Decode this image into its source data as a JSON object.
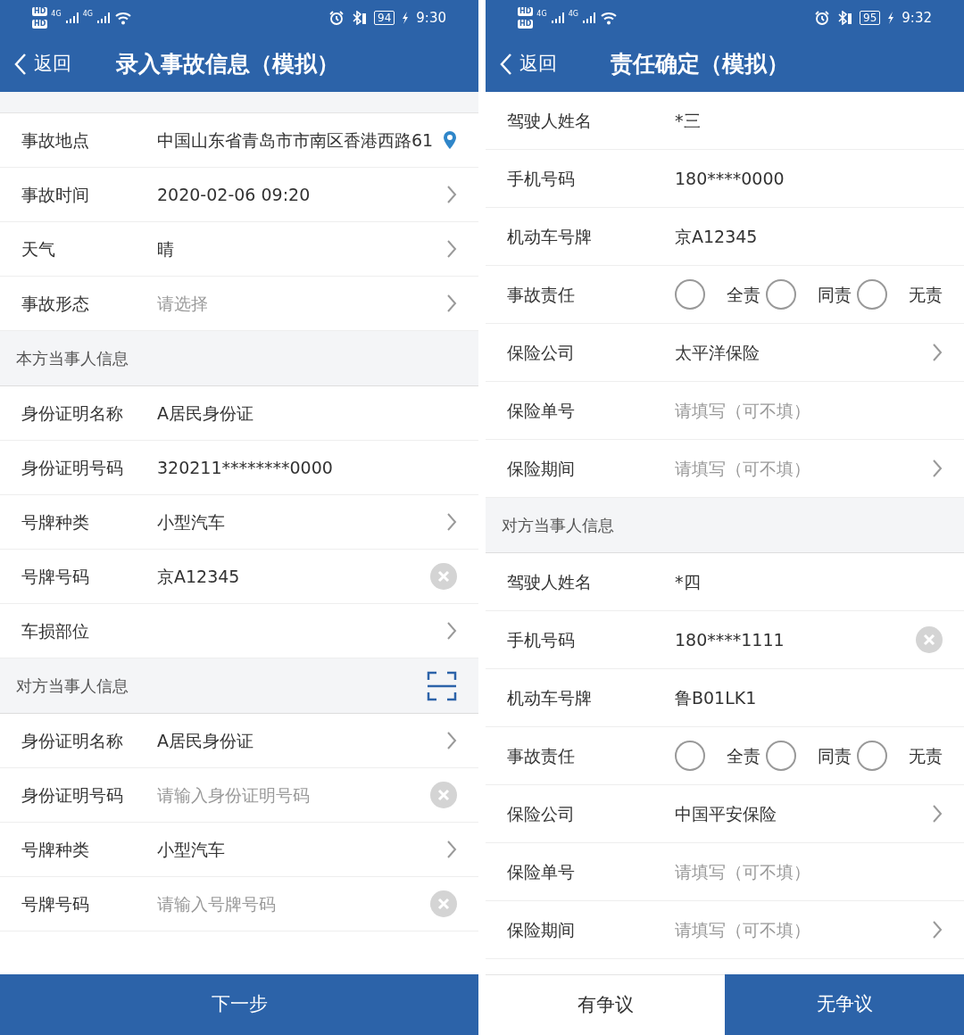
{
  "screens": [
    {
      "status_bar": {
        "sims": [
          "HD",
          "HD"
        ],
        "networks": [
          "4G",
          "4G"
        ],
        "battery": "94",
        "time": "9:30"
      },
      "nav": {
        "back": "返回",
        "title": "录入事故信息（模拟）"
      },
      "sections": [
        {
          "gap": true,
          "rows": [
            {
              "label": "事故地点",
              "value": "中国山东省青岛市市南区香港西路61",
              "kind": "pin"
            },
            {
              "label": "事故时间",
              "value": "2020-02-06 09:20",
              "kind": "chevron"
            },
            {
              "label": "天气",
              "value": "晴",
              "kind": "chevron"
            },
            {
              "label": "事故形态",
              "placeholder": "请选择",
              "kind": "chevron"
            }
          ]
        },
        {
          "title": "本方当事人信息",
          "rows": [
            {
              "label": "身份证明名称",
              "value": "A居民身份证",
              "kind": "plain"
            },
            {
              "label": "身份证明号码",
              "value": "320211********0000",
              "kind": "plain"
            },
            {
              "label": "号牌种类",
              "value": "小型汽车",
              "kind": "chevron"
            },
            {
              "label": "号牌号码",
              "value": "京A12345",
              "kind": "clear"
            },
            {
              "label": "车损部位",
              "kind": "chevron"
            }
          ]
        },
        {
          "title": "对方当事人信息",
          "scan": true,
          "rows": [
            {
              "label": "身份证明名称",
              "value": "A居民身份证",
              "kind": "chevron"
            },
            {
              "label": "身份证明号码",
              "placeholder": "请输入身份证明号码",
              "kind": "clear"
            },
            {
              "label": "号牌种类",
              "value": "小型汽车",
              "kind": "chevron"
            },
            {
              "label": "号牌号码",
              "placeholder": "请输入号牌号码",
              "kind": "clear"
            }
          ]
        }
      ],
      "footer_buttons": [
        {
          "label": "下一步",
          "primary": true
        }
      ]
    },
    {
      "status_bar": {
        "sims": [
          "HD",
          "HD"
        ],
        "networks": [
          "4G",
          "4G"
        ],
        "battery": "95",
        "time": "9:32"
      },
      "nav": {
        "back": "返回",
        "title": "责任确定（模拟）"
      },
      "sections": [
        {
          "rows": [
            {
              "label": "驾驶人姓名",
              "value": "*三",
              "kind": "plain"
            },
            {
              "label": "手机号码",
              "value": "180****0000",
              "kind": "plain"
            },
            {
              "label": "机动车号牌",
              "value": "京A12345",
              "kind": "plain"
            },
            {
              "label": "事故责任",
              "kind": "radio",
              "options": [
                {
                  "label": "全责",
                  "selected": false
                },
                {
                  "label": "同责",
                  "selected": false
                },
                {
                  "label": "无责",
                  "selected": false
                }
              ]
            },
            {
              "label": "保险公司",
              "value": "太平洋保险",
              "kind": "chevron"
            },
            {
              "label": "保险单号",
              "placeholder": "请填写（可不填）",
              "kind": "plain"
            },
            {
              "label": "保险期间",
              "placeholder": "请填写（可不填）",
              "kind": "chevron"
            }
          ]
        },
        {
          "title": "对方当事人信息",
          "rows": [
            {
              "label": "驾驶人姓名",
              "value": "*四",
              "kind": "plain"
            },
            {
              "label": "手机号码",
              "value": "180****1111",
              "kind": "clear"
            },
            {
              "label": "机动车号牌",
              "value": "鲁B01LK1",
              "kind": "plain"
            },
            {
              "label": "事故责任",
              "kind": "radio",
              "options": [
                {
                  "label": "全责",
                  "selected": false
                },
                {
                  "label": "同责",
                  "selected": false
                },
                {
                  "label": "无责",
                  "selected": false
                }
              ]
            },
            {
              "label": "保险公司",
              "value": "中国平安保险",
              "kind": "chevron"
            },
            {
              "label": "保险单号",
              "placeholder": "请填写（可不填）",
              "kind": "plain"
            },
            {
              "label": "保险期间",
              "placeholder": "请填写（可不填）",
              "kind": "chevron"
            }
          ]
        }
      ],
      "footer_buttons": [
        {
          "label": "有争议",
          "primary": false
        },
        {
          "label": "无争议",
          "primary": true
        }
      ]
    }
  ]
}
